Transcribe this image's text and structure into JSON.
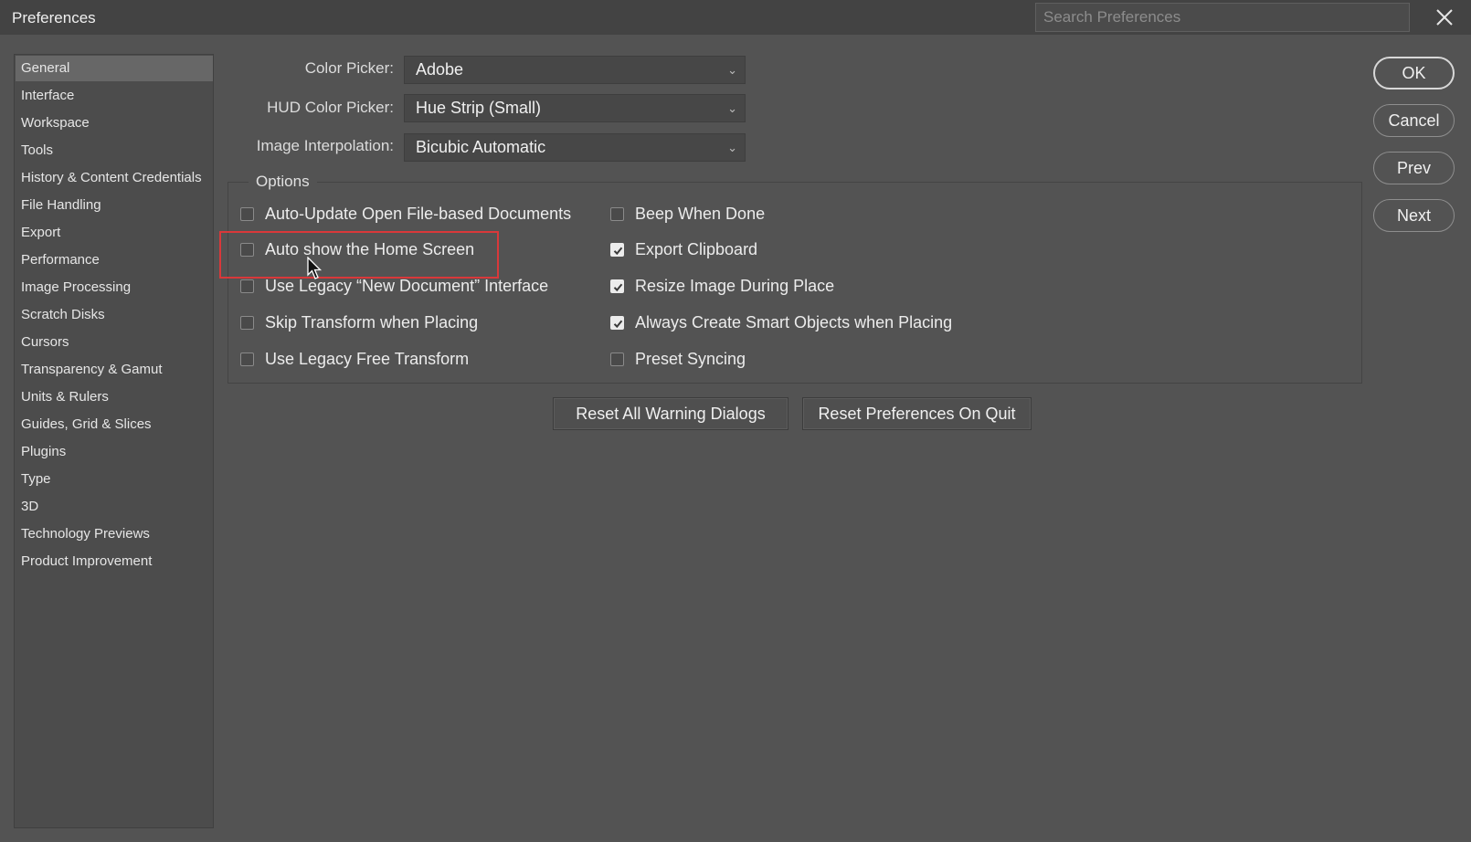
{
  "window": {
    "title": "Preferences"
  },
  "search": {
    "placeholder": "Search Preferences"
  },
  "sidebar": {
    "items": [
      {
        "label": "General",
        "active": true
      },
      {
        "label": "Interface"
      },
      {
        "label": "Workspace"
      },
      {
        "label": "Tools"
      },
      {
        "label": "History & Content Credentials"
      },
      {
        "label": "File Handling"
      },
      {
        "label": "Export"
      },
      {
        "label": "Performance"
      },
      {
        "label": "Image Processing"
      },
      {
        "label": "Scratch Disks"
      },
      {
        "label": "Cursors"
      },
      {
        "label": "Transparency & Gamut"
      },
      {
        "label": "Units & Rulers"
      },
      {
        "label": "Guides, Grid & Slices"
      },
      {
        "label": "Plugins"
      },
      {
        "label": "Type"
      },
      {
        "label": "3D"
      },
      {
        "label": "Technology Previews"
      },
      {
        "label": "Product Improvement"
      }
    ]
  },
  "general": {
    "color_picker": {
      "label": "Color Picker:",
      "value": "Adobe"
    },
    "hud_color_picker": {
      "label": "HUD Color Picker:",
      "value": "Hue Strip (Small)"
    },
    "image_interpolation": {
      "label": "Image Interpolation:",
      "value": "Bicubic Automatic"
    }
  },
  "options": {
    "legend": "Options",
    "left": [
      {
        "label": "Auto-Update Open File-based Documents",
        "checked": false
      },
      {
        "label": "Auto show the Home Screen",
        "checked": false
      },
      {
        "label": "Use Legacy “New Document” Interface",
        "checked": false
      },
      {
        "label": "Skip Transform when Placing",
        "checked": false
      },
      {
        "label": "Use Legacy Free Transform",
        "checked": false
      }
    ],
    "right": [
      {
        "label": "Beep When Done",
        "checked": false
      },
      {
        "label": "Export Clipboard",
        "checked": true
      },
      {
        "label": "Resize Image During Place",
        "checked": true
      },
      {
        "label": "Always Create Smart Objects when Placing",
        "checked": true
      },
      {
        "label": "Preset Syncing",
        "checked": false
      }
    ]
  },
  "reset": {
    "warnings": "Reset All Warning Dialogs",
    "prefs": "Reset Preferences On Quit"
  },
  "actions": {
    "ok": "OK",
    "cancel": "Cancel",
    "prev": "Prev",
    "next": "Next"
  },
  "colors": {
    "background": "#535353",
    "titlebar": "#434343",
    "highlight": "#d9383a"
  }
}
